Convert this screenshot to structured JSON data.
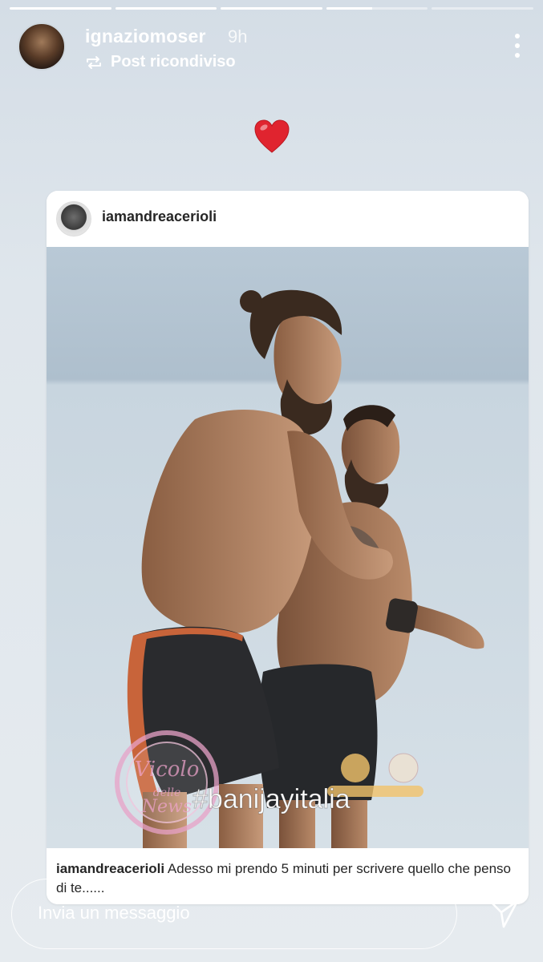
{
  "progress": [
    1,
    1,
    1,
    0.45,
    0
  ],
  "header": {
    "username": "ignaziomoser",
    "time": "9h",
    "repost_label": "Post ricondiviso"
  },
  "sticker": {
    "icon": "heart-icon",
    "color": "#e0242f"
  },
  "post": {
    "username": "iamandreacerioli",
    "photo_hashtag": "#banijayitalia",
    "watermark_text": "Vicolo delle News",
    "caption_user": "iamandreacerioli",
    "caption_text": "Adesso mi prendo 5 minuti per scrivere quello che penso di te......"
  },
  "reply": {
    "placeholder": "Invia un messaggio"
  }
}
